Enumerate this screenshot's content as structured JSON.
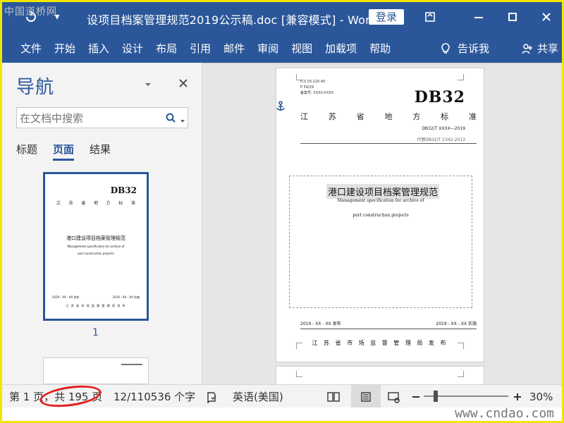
{
  "window": {
    "title": "设项目档案管理规范2019公示稿.doc [兼容模式]  -  Word",
    "login_label": "登录"
  },
  "watermarks": {
    "top_left": "中国道桥网",
    "bottom_right": "www.cndao.com"
  },
  "ribbon": {
    "tabs": [
      "文件",
      "开始",
      "插入",
      "设计",
      "布局",
      "引用",
      "邮件",
      "审阅",
      "视图",
      "加载项",
      "帮助"
    ],
    "tell_me": "告诉我",
    "share": "共享"
  },
  "navigation": {
    "title": "导航",
    "search_placeholder": "在文档中搜索",
    "tabs": [
      {
        "label": "标题",
        "active": false
      },
      {
        "label": "页面",
        "active": true
      },
      {
        "label": "结果",
        "active": false
      }
    ],
    "thumb_page_number": "1"
  },
  "document_page": {
    "ics_line": "ICS 03.220.40",
    "p_line": "P 59/29",
    "record_line": "备案号: XXXX-XXXX",
    "db_code": "DB32",
    "standard_title_chars": [
      "江",
      "苏",
      "省",
      "地",
      "方",
      "标",
      "准"
    ],
    "standard_number": "DB32/T XXXX—2019",
    "replaces": "代替DB32/T 2342-2013",
    "title_cn": "港口建设项目档案管理规范",
    "title_en_line1": "Management specification for archive of",
    "title_en_line2": "port construction projects",
    "release_left": "2019 - XX - XX 发布",
    "release_right": "2019 - XX - XX 实施",
    "publisher": "江 苏 省 市 场 监 督 管 理 局    发 布"
  },
  "statusbar": {
    "page_info": "第 1 页，共 195 页",
    "word_count": "12/110536 个字",
    "language": "英语(美国)",
    "zoom_percent": "30%"
  },
  "colors": {
    "word_blue": "#2b579a",
    "frame_yellow": "#f2e600",
    "annotation_red": "#e32020"
  }
}
